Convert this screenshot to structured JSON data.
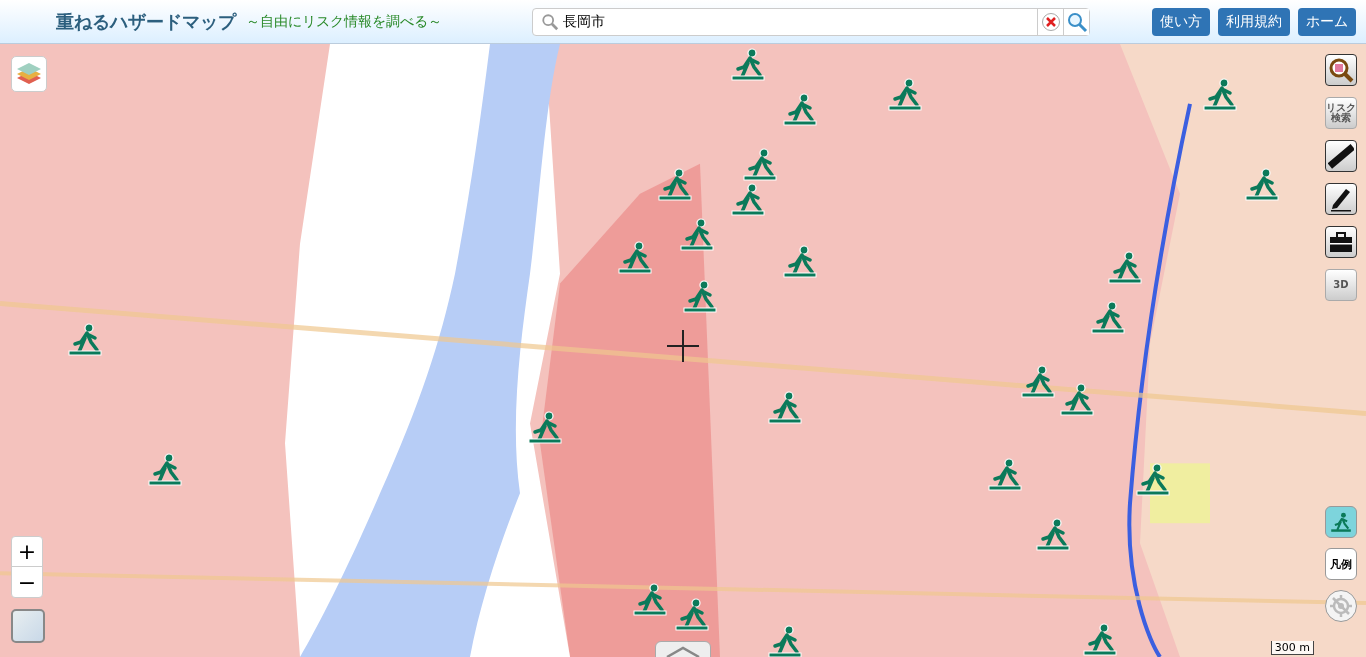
{
  "header": {
    "title": "重ねるハザードマップ",
    "subtitle": "～自由にリスク情報を調べる～",
    "search": {
      "value": "長岡市"
    },
    "nav_buttons": [
      "使い方",
      "利用規約",
      "ホーム"
    ]
  },
  "map": {
    "layers_button": {
      "kind": "layers"
    },
    "tools": [
      {
        "kind": "map-search"
      },
      {
        "kind": "text",
        "label": "リスク検索"
      },
      {
        "kind": "ruler"
      },
      {
        "kind": "pencil"
      },
      {
        "kind": "toolbox"
      },
      {
        "kind": "text",
        "label": "3D"
      }
    ],
    "zoom_buttons": [
      "+",
      "−"
    ],
    "evacuation_toggle": {
      "selected": true
    },
    "legend_button": "凡例",
    "scale": "300 m"
  }
}
